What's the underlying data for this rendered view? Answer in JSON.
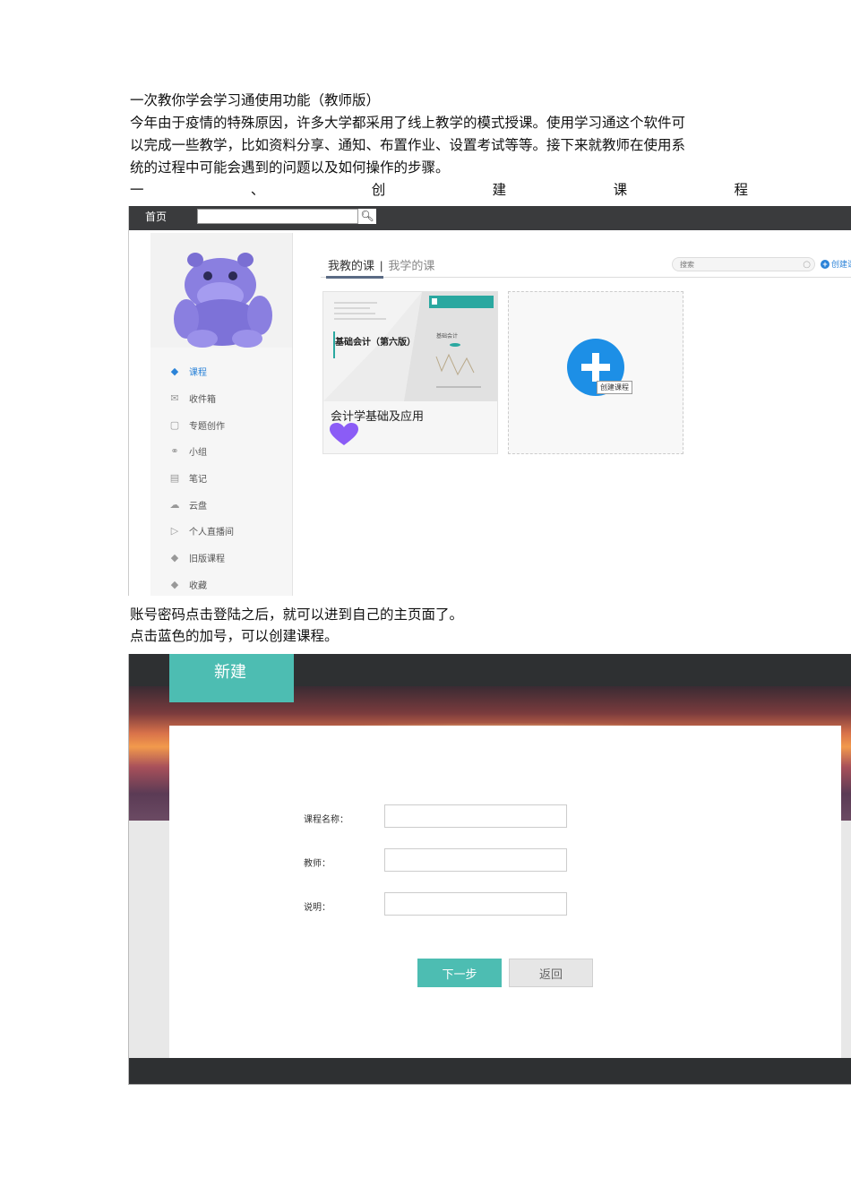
{
  "document": {
    "title": "一次教你学会学习通使用功能（教师版）",
    "intro_lines": [
      "今年由于疫情的特殊原因，许多大学都采用了线上教学的模式授课。使用学习通这个软件可",
      "以完成一些教学，比如资料分享、通知、布置作业、设置考试等等。接下来就教师在使用系",
      "统的过程中可能会遇到的问题以及如何操作的步骤。"
    ],
    "section_heading_chars": [
      "一",
      "、",
      "创",
      "建",
      "课",
      "程"
    ],
    "caption1": "账号密码点击登陆之后，就可以进到自己的主页面了。",
    "caption2": "点击蓝色的加号，可以创建课程。"
  },
  "screenshot1": {
    "topbar": {
      "home": "首页",
      "search_icon": "search-icon"
    },
    "sidebar": {
      "avatar_icon": "purple-hippo-avatar",
      "items": [
        {
          "label": "课程",
          "icon": "graduation-cap-icon",
          "active": true
        },
        {
          "label": "收件箱",
          "icon": "inbox-icon"
        },
        {
          "label": "专题创作",
          "icon": "window-icon"
        },
        {
          "label": "小组",
          "icon": "group-icon"
        },
        {
          "label": "笔记",
          "icon": "note-icon"
        },
        {
          "label": "云盘",
          "icon": "cloud-icon"
        },
        {
          "label": "个人直播间",
          "icon": "play-icon"
        },
        {
          "label": "旧版课程",
          "icon": "graduation-cap-icon"
        },
        {
          "label": "收藏",
          "icon": "graduation-cap-icon"
        }
      ]
    },
    "tabs": {
      "teach": "我教的课",
      "separator": "|",
      "learn": "我学的课"
    },
    "search_placeholder": "搜索",
    "create_link": "创建课",
    "course_card": {
      "cover_title": "基础会计（第六版）",
      "cover_small": "基础会计",
      "name": "会计学基础及应用"
    },
    "create_card": {
      "tooltip": "创建课程"
    },
    "colors": {
      "accent": "#1d8fe6",
      "topbar": "#3a3b3d",
      "heart": "#8b5cf6"
    }
  },
  "screenshot2": {
    "tab_label": "新建",
    "fields": [
      {
        "label": "课程名称：",
        "value": ""
      },
      {
        "label": "教师：",
        "value": ""
      },
      {
        "label": "说明：",
        "value": ""
      }
    ],
    "next_button": "下一步",
    "back_button": "返回",
    "colors": {
      "teal": "#4dbdb2",
      "dark": "#2e3032"
    }
  }
}
